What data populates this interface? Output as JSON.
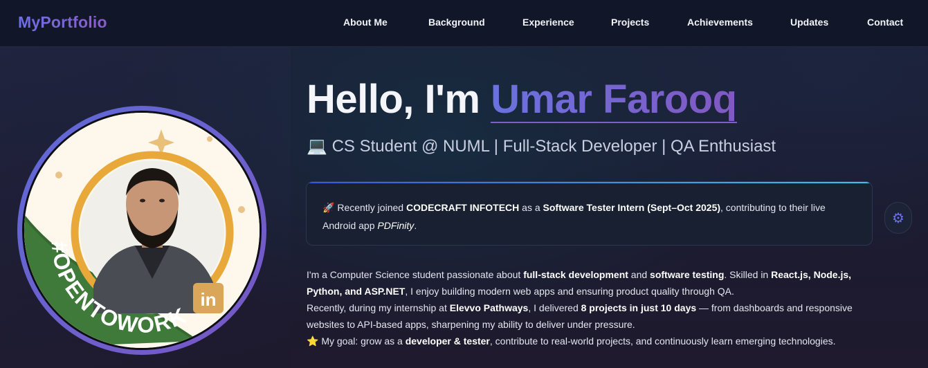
{
  "nav": {
    "logo": "MyPortfolio",
    "links": [
      "About Me",
      "Background",
      "Experience",
      "Projects",
      "Achievements",
      "Updates",
      "Contact"
    ]
  },
  "avatar": {
    "badge_text": "#OPENTOWORK",
    "social_icon": "linkedin-icon"
  },
  "hero": {
    "greeting": "Hello, I'm ",
    "name": "Umar Farooq",
    "subtitle_icon": "💻",
    "subtitle": "CS Student @ NUML | Full-Stack Developer | QA Enthusiast"
  },
  "announcement": {
    "icon": "🚀",
    "t1": " Recently joined ",
    "company": "CODECRAFT INFOTECH",
    "t2": " as a ",
    "role": "Software Tester Intern (Sept–Oct 2025)",
    "t3": ", contributing to their live Android app ",
    "app": "PDFinity",
    "t4": "."
  },
  "settings_icon": "gear-icon",
  "about": {
    "p1_a": "I'm a Computer Science student passionate about ",
    "p1_b": "full-stack development",
    "p1_c": " and ",
    "p1_d": "software testing",
    "p1_e": ". Skilled in ",
    "p1_f": "React.js, Node.js, Python, and ASP.NET",
    "p1_g": ", I enjoy building modern web apps and ensuring product quality through QA.",
    "p2_a": "Recently, during my internship at ",
    "p2_b": "Elevvo Pathways",
    "p2_c": ", I delivered ",
    "p2_d": "8 projects in just 10 days",
    "p2_e": " — from dashboards and responsive websites to API-based apps, sharpening my ability to deliver under pressure.",
    "p3_icon": "⭐",
    "p3_a": " My goal: grow as a ",
    "p3_b": "developer & tester",
    "p3_c": ", contribute to real-world projects, and continuously learn emerging technologies."
  }
}
